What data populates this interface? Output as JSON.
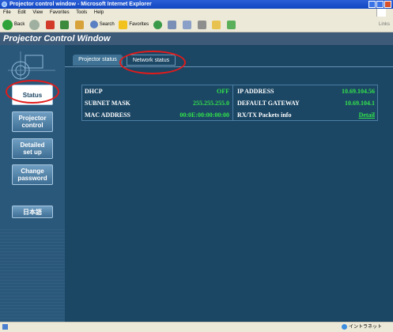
{
  "browser": {
    "title": "Projector control window - Microsoft Internet Explorer",
    "menu": [
      "File",
      "Edit",
      "View",
      "Favorites",
      "Tools",
      "Help"
    ],
    "toolbar": {
      "back_label": "Back",
      "search_label": "Search",
      "favorites_label": "Favorites",
      "links_label": "Links"
    },
    "status_zone": "イントラネット"
  },
  "app": {
    "title": "Projector Control Window",
    "tabs": [
      {
        "label": "Projector status"
      },
      {
        "label": "Network status"
      }
    ],
    "sidebar": [
      {
        "label": "Status"
      },
      {
        "label": "Projector control"
      },
      {
        "label": "Detailed set up"
      },
      {
        "label": "Change password"
      },
      {
        "label": "日本語"
      }
    ],
    "network": {
      "dhcp_label": "DHCP",
      "dhcp_value": "OFF",
      "ip_label": "IP ADDRESS",
      "ip_value": "10.69.104.56",
      "subnet_label": "SUBNET MASK",
      "subnet_value": "255.255.255.0",
      "gateway_label": "DEFAULT GATEWAY",
      "gateway_value": "10.69.104.1",
      "mac_label": "MAC ADDRESS",
      "mac_value": "00:0E:00:00:00:00",
      "packets_label": "RX/TX Packets info",
      "packets_link": "Detail"
    }
  },
  "colors": {
    "app_bg": "#1b4664",
    "sidebar_bg": "#2a587a",
    "value_green": "#33e24b",
    "highlight_red": "#e21b1b"
  }
}
